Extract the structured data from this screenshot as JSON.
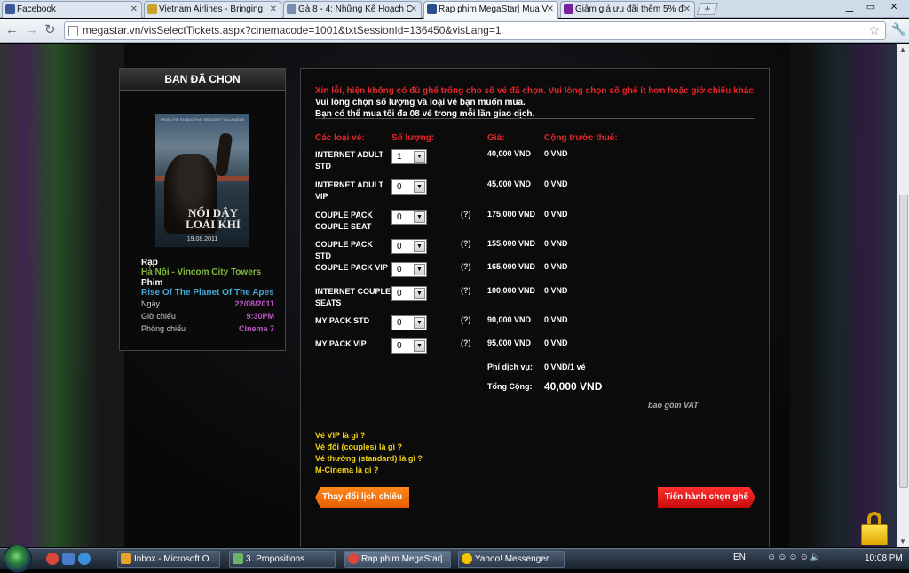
{
  "browser": {
    "tabs": [
      {
        "label": "Facebook",
        "icon": "facebook-icon",
        "color": "#3b5998"
      },
      {
        "label": "Vietnam Airlines - Bringing",
        "icon": "airline-icon",
        "color": "#c7a32a"
      },
      {
        "label": "Gà 8 - 4: Những Kế Hoạch C",
        "icon": "page-icon",
        "color": "#7a8fb0"
      },
      {
        "label": "Rap phim MegaStar| Mua V",
        "icon": "megastar-icon",
        "color": "#2a4f8a"
      },
      {
        "label": "Giảm giá ưu đãi thêm 5% đ",
        "icon": "yahoo-icon",
        "color": "#7b1fa2"
      }
    ],
    "url": "megastar.vn/visSelectTickets.aspx?cinemacode=1001&txtSessionId=136450&visLang=1"
  },
  "left_panel": {
    "title": "BẠN ĐÃ CHỌN",
    "poster": {
      "title_line1": "NỔI DẬY",
      "title_line2": "LOÀI KHỈ",
      "date": "19.08.2011",
      "credit": "FROM THE STUDIO THAT BROUGHT YOU AVATAR"
    },
    "cinema_label": "Rạp",
    "cinema_value": "Hà Nội - Vincom City Towers",
    "movie_label": "Phim",
    "movie_value": "Rise Of The Planet Of The Apes",
    "date_label": "Ngày",
    "date_value": "22/08/2011",
    "time_label": "Giờ chiếu",
    "time_value": "9:30PM",
    "room_label": "Phòng chiếu",
    "room_value": "Cinema 7"
  },
  "main": {
    "error_red": "Xin lỗi, hiện không có đủ ghế trống cho số vé đã chọn. Vui lòng chọn số ghế ít hơn hoặc giờ chiếu khác.",
    "error_white": " Vui lòng chọn số lượng và loại vé bạn muốn mua.",
    "limit_note": "Bạn có thể mua tối đa 08 vé trong mỗi lần giao dịch.",
    "headers": {
      "type": "Các loại vé:",
      "qty": "Số lượng:",
      "price": "Giá:",
      "subtotal": "Cộng trước thuế:"
    },
    "tickets": [
      {
        "name": "INTERNET ADULT STD",
        "qty": "1",
        "help": "",
        "price": "40,000 VND",
        "subtotal": "0 VND"
      },
      {
        "name": "INTERNET ADULT VIP",
        "qty": "0",
        "help": "",
        "price": "45,000 VND",
        "subtotal": "0 VND"
      },
      {
        "name": "COUPLE PACK COUPLE SEAT",
        "qty": "0",
        "help": "(?)",
        "price": "175,000 VND",
        "subtotal": "0 VND"
      },
      {
        "name": "COUPLE PACK STD",
        "qty": "0",
        "help": "(?)",
        "price": "155,000 VND",
        "subtotal": "0 VND"
      },
      {
        "name": "COUPLE PACK VIP",
        "qty": "0",
        "help": "(?)",
        "price": "165,000 VND",
        "subtotal": "0 VND"
      },
      {
        "name": "INTERNET COUPLE SEATS",
        "qty": "0",
        "help": "(?)",
        "price": "100,000 VND",
        "subtotal": "0 VND"
      },
      {
        "name": "MY PACK STD",
        "qty": "0",
        "help": "(?)",
        "price": "90,000 VND",
        "subtotal": "0 VND"
      },
      {
        "name": "MY PACK VIP",
        "qty": "0",
        "help": "(?)",
        "price": "95,000 VND",
        "subtotal": "0 VND"
      }
    ],
    "fee_label": "Phí dịch vụ:",
    "fee_value": "0 VND/1 vé",
    "total_label": "Tổng Cộng:",
    "total_value": "40,000 VND",
    "vat_note": "bao gồm VAT",
    "faq": [
      "Vé VIP là gì ?",
      "Vé đôi (couples) là gì ?",
      "Vé thường (standard) là gì ?",
      "M-Cinema là gì ?"
    ],
    "back_button": "Thay đổi lịch chiếu",
    "next_button": "Tiến hành chọn ghế"
  },
  "taskbar": {
    "items": [
      {
        "label": "Inbox - Microsoft O...",
        "icon": "outlook-icon",
        "color": "#e8a12a"
      },
      {
        "label": "3. Propositions",
        "icon": "document-icon",
        "color": "#6bb36b"
      },
      {
        "label": "Rap phim MegaStar|...",
        "icon": "chrome-icon",
        "color": "#d9473a"
      },
      {
        "label": "Yahoo! Messenger",
        "icon": "yahoo-messenger-icon",
        "color": "#f2c400"
      }
    ],
    "lang": "EN",
    "clock": "10:08 PM"
  },
  "colors": {
    "accent_red": "#e8262a",
    "cinema_green": "#7cb83a",
    "movie_blue": "#47a8d6",
    "value_purple": "#c05ac8",
    "faq_yellow": "#f2d215"
  }
}
